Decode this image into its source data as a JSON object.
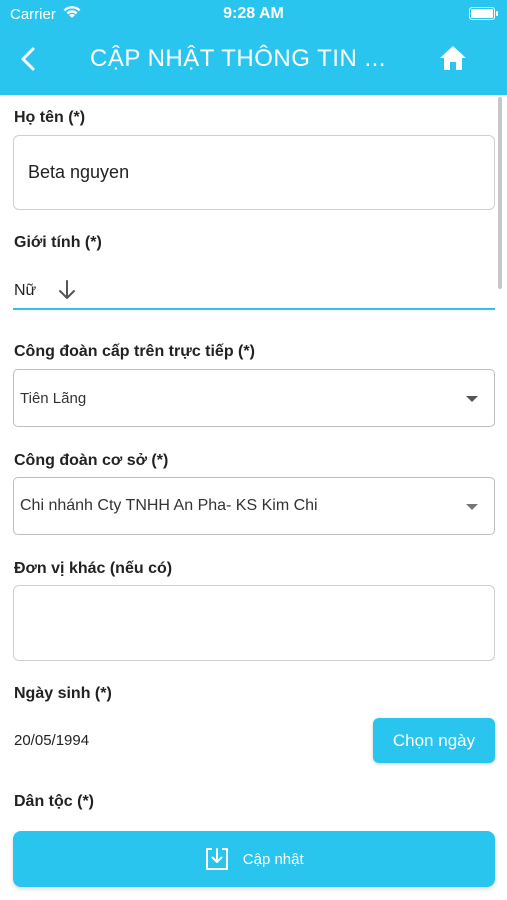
{
  "status_bar": {
    "carrier": "Carrier",
    "time": "9:28 AM"
  },
  "nav": {
    "title": "CẬP NHẬT THÔNG TIN ...",
    "back_icon": "chevron-left-icon",
    "home_icon": "home-icon"
  },
  "form": {
    "name": {
      "label": "Họ tên (*)",
      "value": "Beta nguyen"
    },
    "gender": {
      "label": "Giới tính (*)",
      "value": "Nữ"
    },
    "upper_union": {
      "label": "Công đoàn cấp trên trực tiếp (*)",
      "value": "Tiên Lãng"
    },
    "base_union": {
      "label": "Công đoàn cơ sở (*)",
      "value": "Chi nhánh Cty TNHH An Pha- KS Kim Chi"
    },
    "other_unit": {
      "label": "Đơn vị khác (nếu có)",
      "value": ""
    },
    "birthday": {
      "label": "Ngày sinh (*)",
      "value": "20/05/1994",
      "button": "Chọn ngày"
    },
    "ethnicity": {
      "label": "Dân tộc (*)"
    }
  },
  "submit": {
    "label": "Cập nhật",
    "icon": "download-icon"
  },
  "colors": {
    "accent": "#29c5ef"
  }
}
